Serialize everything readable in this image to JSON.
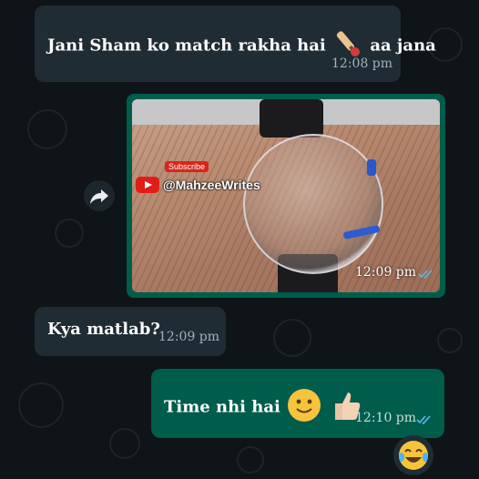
{
  "conversation": {
    "messages": [
      {
        "direction": "incoming",
        "text_before": "Jani Sham ko match rakha hai",
        "emoji": "cricket-bat-icon",
        "text_after": "aa jana",
        "time": "12:08 pm"
      },
      {
        "direction": "outgoing",
        "type": "image",
        "overlay": {
          "subscribe": "Subscribe",
          "handle": "@MahzeeWrites"
        },
        "time": "12:09 pm",
        "status": "read"
      },
      {
        "direction": "incoming",
        "text": "Kya matlab?",
        "time": "12:09 pm"
      },
      {
        "direction": "outgoing",
        "text": "Time nhi hai",
        "emojis": [
          "slightly-smiling-face-icon",
          "thumbs-up-icon"
        ],
        "time": "12:10 pm",
        "status": "read"
      }
    ],
    "reaction": "face-with-tears-of-joy-icon"
  },
  "colors": {
    "incoming_bubble": "#1f2c34",
    "outgoing_bubble": "#005c4b",
    "read_ticks": "#53bdeb",
    "background": "#0b1014"
  }
}
